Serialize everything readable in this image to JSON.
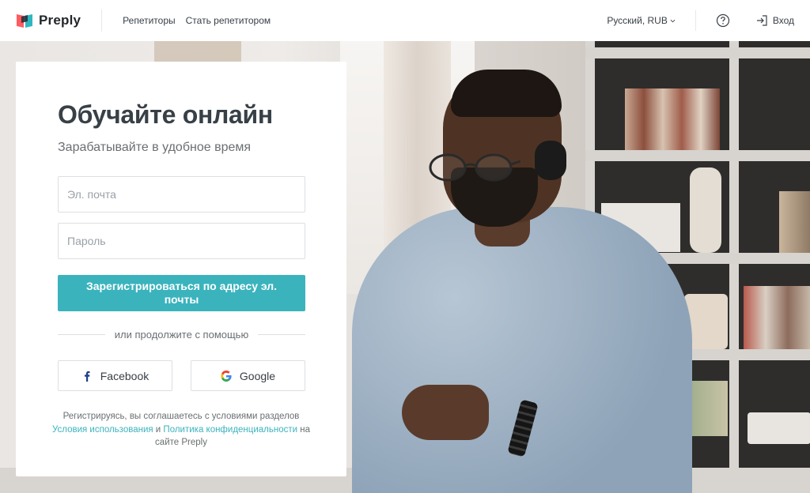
{
  "brand": {
    "name": "Preply"
  },
  "nav": {
    "tutors": "Репетиторы",
    "become_tutor": "Стать репетитором"
  },
  "header": {
    "language": "Русский, RUB",
    "login": "Вход"
  },
  "card": {
    "title": "Обучайте онлайн",
    "subtitle": "Зарабатывайте в удобное время",
    "email_placeholder": "Эл. почта",
    "password_placeholder": "Пароль",
    "submit_label": "Зарегистрироваться по адресу эл. почты",
    "divider_text": "или продолжите с помощью",
    "facebook_label": "Facebook",
    "google_label": "Google",
    "terms_prefix": "Регистрируясь, вы соглашаетесь с условиями разделов",
    "terms_link": "Условия использования",
    "terms_and": " и ",
    "privacy_link": "Политика конфиденциальности",
    "terms_suffix": " на сайте Preply"
  },
  "colors": {
    "accent": "#3bb3bd",
    "text": "#384047",
    "facebook": "#1877f2"
  },
  "icons": {
    "help": "question-circle-icon",
    "login": "sign-in-icon",
    "chevron": "chevron-down-icon"
  }
}
